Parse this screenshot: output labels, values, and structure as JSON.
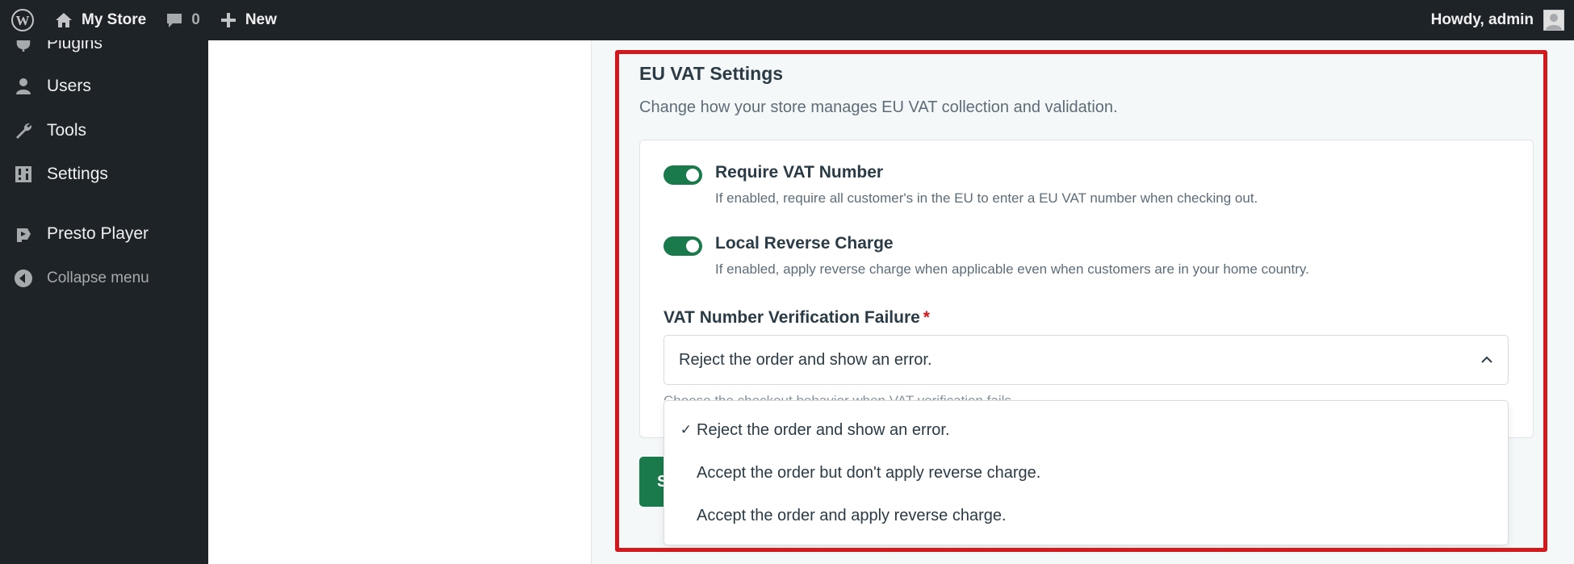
{
  "admin_bar": {
    "site_name": "My Store",
    "comments_count": "0",
    "new_label": "New",
    "howdy": "Howdy, admin"
  },
  "sidebar": {
    "items": [
      {
        "label": "Plugins",
        "icon": "plugin-icon"
      },
      {
        "label": "Users",
        "icon": "users-icon"
      },
      {
        "label": "Tools",
        "icon": "wrench-icon"
      },
      {
        "label": "Settings",
        "icon": "settings-icon"
      },
      {
        "label": "Presto Player",
        "icon": "presto-player-icon"
      },
      {
        "label": "Collapse menu",
        "icon": "collapse-icon"
      }
    ]
  },
  "vat": {
    "title": "EU VAT Settings",
    "description": "Change how your store manages EU VAT collection and validation.",
    "toggles": [
      {
        "label": "Require VAT Number",
        "help": "If enabled, require all customer's in the EU to enter a EU VAT number when checking out.",
        "enabled": true
      },
      {
        "label": "Local Reverse Charge",
        "help": "If enabled, apply reverse charge when applicable even when customers are in your home country.",
        "enabled": true
      }
    ],
    "field_label": "VAT Number Verification Failure",
    "required_mark": "*",
    "selected_value": "Reject the order and show an error.",
    "field_help": "Choose the checkout behavior when VAT verification fails.",
    "options": [
      {
        "label": "Reject the order and show an error.",
        "selected": true,
        "check": "✓"
      },
      {
        "label": "Accept the order but don't apply reverse charge.",
        "selected": false,
        "check": ""
      },
      {
        "label": "Accept the order and apply reverse charge.",
        "selected": false,
        "check": ""
      }
    ],
    "save_label": "Save"
  },
  "colors": {
    "accent_green": "#1a7a4c",
    "highlight_red": "#d3191c",
    "admin_dark": "#1d2327"
  }
}
